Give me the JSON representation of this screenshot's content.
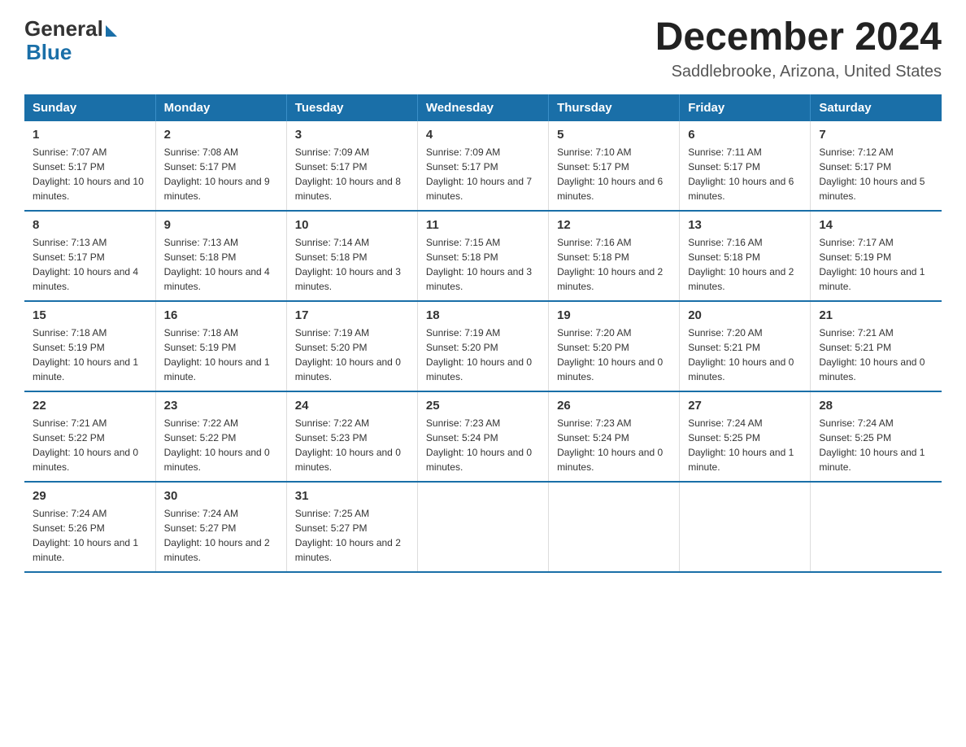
{
  "header": {
    "logo_general": "General",
    "logo_blue": "Blue",
    "title": "December 2024",
    "location": "Saddlebrooke, Arizona, United States"
  },
  "days_of_week": [
    "Sunday",
    "Monday",
    "Tuesday",
    "Wednesday",
    "Thursday",
    "Friday",
    "Saturday"
  ],
  "weeks": [
    [
      {
        "day": "1",
        "sunrise": "7:07 AM",
        "sunset": "5:17 PM",
        "daylight": "10 hours and 10 minutes."
      },
      {
        "day": "2",
        "sunrise": "7:08 AM",
        "sunset": "5:17 PM",
        "daylight": "10 hours and 9 minutes."
      },
      {
        "day": "3",
        "sunrise": "7:09 AM",
        "sunset": "5:17 PM",
        "daylight": "10 hours and 8 minutes."
      },
      {
        "day": "4",
        "sunrise": "7:09 AM",
        "sunset": "5:17 PM",
        "daylight": "10 hours and 7 minutes."
      },
      {
        "day": "5",
        "sunrise": "7:10 AM",
        "sunset": "5:17 PM",
        "daylight": "10 hours and 6 minutes."
      },
      {
        "day": "6",
        "sunrise": "7:11 AM",
        "sunset": "5:17 PM",
        "daylight": "10 hours and 6 minutes."
      },
      {
        "day": "7",
        "sunrise": "7:12 AM",
        "sunset": "5:17 PM",
        "daylight": "10 hours and 5 minutes."
      }
    ],
    [
      {
        "day": "8",
        "sunrise": "7:13 AM",
        "sunset": "5:17 PM",
        "daylight": "10 hours and 4 minutes."
      },
      {
        "day": "9",
        "sunrise": "7:13 AM",
        "sunset": "5:18 PM",
        "daylight": "10 hours and 4 minutes."
      },
      {
        "day": "10",
        "sunrise": "7:14 AM",
        "sunset": "5:18 PM",
        "daylight": "10 hours and 3 minutes."
      },
      {
        "day": "11",
        "sunrise": "7:15 AM",
        "sunset": "5:18 PM",
        "daylight": "10 hours and 3 minutes."
      },
      {
        "day": "12",
        "sunrise": "7:16 AM",
        "sunset": "5:18 PM",
        "daylight": "10 hours and 2 minutes."
      },
      {
        "day": "13",
        "sunrise": "7:16 AM",
        "sunset": "5:18 PM",
        "daylight": "10 hours and 2 minutes."
      },
      {
        "day": "14",
        "sunrise": "7:17 AM",
        "sunset": "5:19 PM",
        "daylight": "10 hours and 1 minute."
      }
    ],
    [
      {
        "day": "15",
        "sunrise": "7:18 AM",
        "sunset": "5:19 PM",
        "daylight": "10 hours and 1 minute."
      },
      {
        "day": "16",
        "sunrise": "7:18 AM",
        "sunset": "5:19 PM",
        "daylight": "10 hours and 1 minute."
      },
      {
        "day": "17",
        "sunrise": "7:19 AM",
        "sunset": "5:20 PM",
        "daylight": "10 hours and 0 minutes."
      },
      {
        "day": "18",
        "sunrise": "7:19 AM",
        "sunset": "5:20 PM",
        "daylight": "10 hours and 0 minutes."
      },
      {
        "day": "19",
        "sunrise": "7:20 AM",
        "sunset": "5:20 PM",
        "daylight": "10 hours and 0 minutes."
      },
      {
        "day": "20",
        "sunrise": "7:20 AM",
        "sunset": "5:21 PM",
        "daylight": "10 hours and 0 minutes."
      },
      {
        "day": "21",
        "sunrise": "7:21 AM",
        "sunset": "5:21 PM",
        "daylight": "10 hours and 0 minutes."
      }
    ],
    [
      {
        "day": "22",
        "sunrise": "7:21 AM",
        "sunset": "5:22 PM",
        "daylight": "10 hours and 0 minutes."
      },
      {
        "day": "23",
        "sunrise": "7:22 AM",
        "sunset": "5:22 PM",
        "daylight": "10 hours and 0 minutes."
      },
      {
        "day": "24",
        "sunrise": "7:22 AM",
        "sunset": "5:23 PM",
        "daylight": "10 hours and 0 minutes."
      },
      {
        "day": "25",
        "sunrise": "7:23 AM",
        "sunset": "5:24 PM",
        "daylight": "10 hours and 0 minutes."
      },
      {
        "day": "26",
        "sunrise": "7:23 AM",
        "sunset": "5:24 PM",
        "daylight": "10 hours and 0 minutes."
      },
      {
        "day": "27",
        "sunrise": "7:24 AM",
        "sunset": "5:25 PM",
        "daylight": "10 hours and 1 minute."
      },
      {
        "day": "28",
        "sunrise": "7:24 AM",
        "sunset": "5:25 PM",
        "daylight": "10 hours and 1 minute."
      }
    ],
    [
      {
        "day": "29",
        "sunrise": "7:24 AM",
        "sunset": "5:26 PM",
        "daylight": "10 hours and 1 minute."
      },
      {
        "day": "30",
        "sunrise": "7:24 AM",
        "sunset": "5:27 PM",
        "daylight": "10 hours and 2 minutes."
      },
      {
        "day": "31",
        "sunrise": "7:25 AM",
        "sunset": "5:27 PM",
        "daylight": "10 hours and 2 minutes."
      },
      {
        "day": "",
        "sunrise": "",
        "sunset": "",
        "daylight": ""
      },
      {
        "day": "",
        "sunrise": "",
        "sunset": "",
        "daylight": ""
      },
      {
        "day": "",
        "sunrise": "",
        "sunset": "",
        "daylight": ""
      },
      {
        "day": "",
        "sunrise": "",
        "sunset": "",
        "daylight": ""
      }
    ]
  ]
}
